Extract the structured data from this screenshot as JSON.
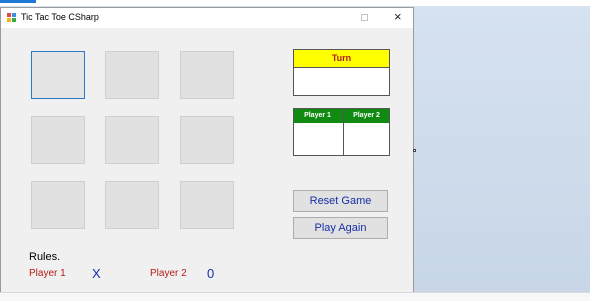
{
  "window": {
    "title": "Tic Tac Toe CSharp"
  },
  "board": {
    "cells": [
      "",
      "",
      "",
      "",
      "",
      "",
      "",
      "",
      ""
    ]
  },
  "turn": {
    "header": "Turn",
    "value": ""
  },
  "scores": {
    "columns": [
      "Player 1",
      "Player 2"
    ],
    "values": [
      "",
      ""
    ]
  },
  "buttons": {
    "reset": "Reset Game",
    "play_again": "Play Again"
  },
  "rules": {
    "label": "Rules."
  },
  "players": {
    "p1_label": "Player 1",
    "p1_mark": "X",
    "p2_label": "Player 2",
    "p2_mark": "0"
  },
  "colors": {
    "turn_header_bg": "#ffff00",
    "turn_header_text": "#b41b1b",
    "score_header_bg": "#118a11",
    "player_label": "#b51b1b",
    "mark_and_button_text": "#1730a6",
    "focus_border": "#2b78c8"
  }
}
